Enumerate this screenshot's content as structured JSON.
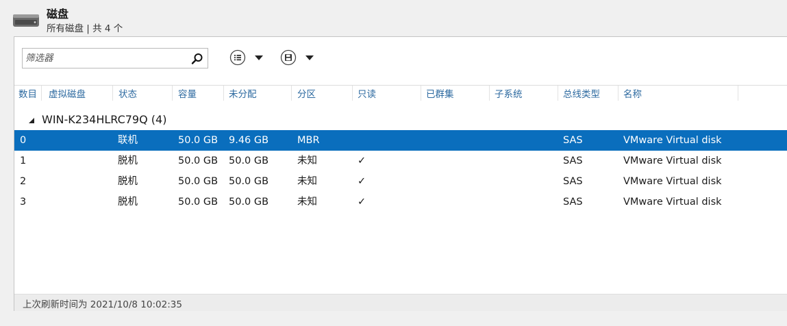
{
  "header": {
    "icon": "disk-drive-icon",
    "title": "磁盘",
    "subtitle": "所有磁盘 | 共 4 个"
  },
  "toolbar": {
    "filter_placeholder": "筛选器",
    "filter_value": "",
    "search_icon": "search-icon",
    "view_icon": "list-view-icon",
    "save_icon": "save-icon"
  },
  "columns": {
    "number": "数目",
    "virtual_disk": "虚拟磁盘",
    "status": "状态",
    "capacity": "容量",
    "unallocated": "未分配",
    "partition": "分区",
    "readonly": "只读",
    "clustered": "已群集",
    "subsystem": "子系统",
    "bus_type": "总线类型",
    "name": "名称"
  },
  "group": {
    "label": "WIN-K234HLRC79Q (4)"
  },
  "rows": [
    {
      "number": "0",
      "virtual_disk": "",
      "status": "联机",
      "capacity": "50.0 GB",
      "unallocated": "9.46 GB",
      "partition": "MBR",
      "readonly": "",
      "clustered": "",
      "subsystem": "",
      "bus_type": "SAS",
      "name": "VMware Virtual disk",
      "selected": true
    },
    {
      "number": "1",
      "virtual_disk": "",
      "status": "脱机",
      "capacity": "50.0 GB",
      "unallocated": "50.0 GB",
      "partition": "未知",
      "readonly": "✓",
      "clustered": "",
      "subsystem": "",
      "bus_type": "SAS",
      "name": "VMware Virtual disk",
      "selected": false
    },
    {
      "number": "2",
      "virtual_disk": "",
      "status": "脱机",
      "capacity": "50.0 GB",
      "unallocated": "50.0 GB",
      "partition": "未知",
      "readonly": "✓",
      "clustered": "",
      "subsystem": "",
      "bus_type": "SAS",
      "name": "VMware Virtual disk",
      "selected": false
    },
    {
      "number": "3",
      "virtual_disk": "",
      "status": "脱机",
      "capacity": "50.0 GB",
      "unallocated": "50.0 GB",
      "partition": "未知",
      "readonly": "✓",
      "clustered": "",
      "subsystem": "",
      "bus_type": "SAS",
      "name": "VMware Virtual disk",
      "selected": false
    }
  ],
  "status_bar": {
    "text": "上次刷新时间为 2021/10/8 10:02:35"
  },
  "colors": {
    "selected_row": "#0a6ebd",
    "column_header_text": "#2d6aa0"
  }
}
